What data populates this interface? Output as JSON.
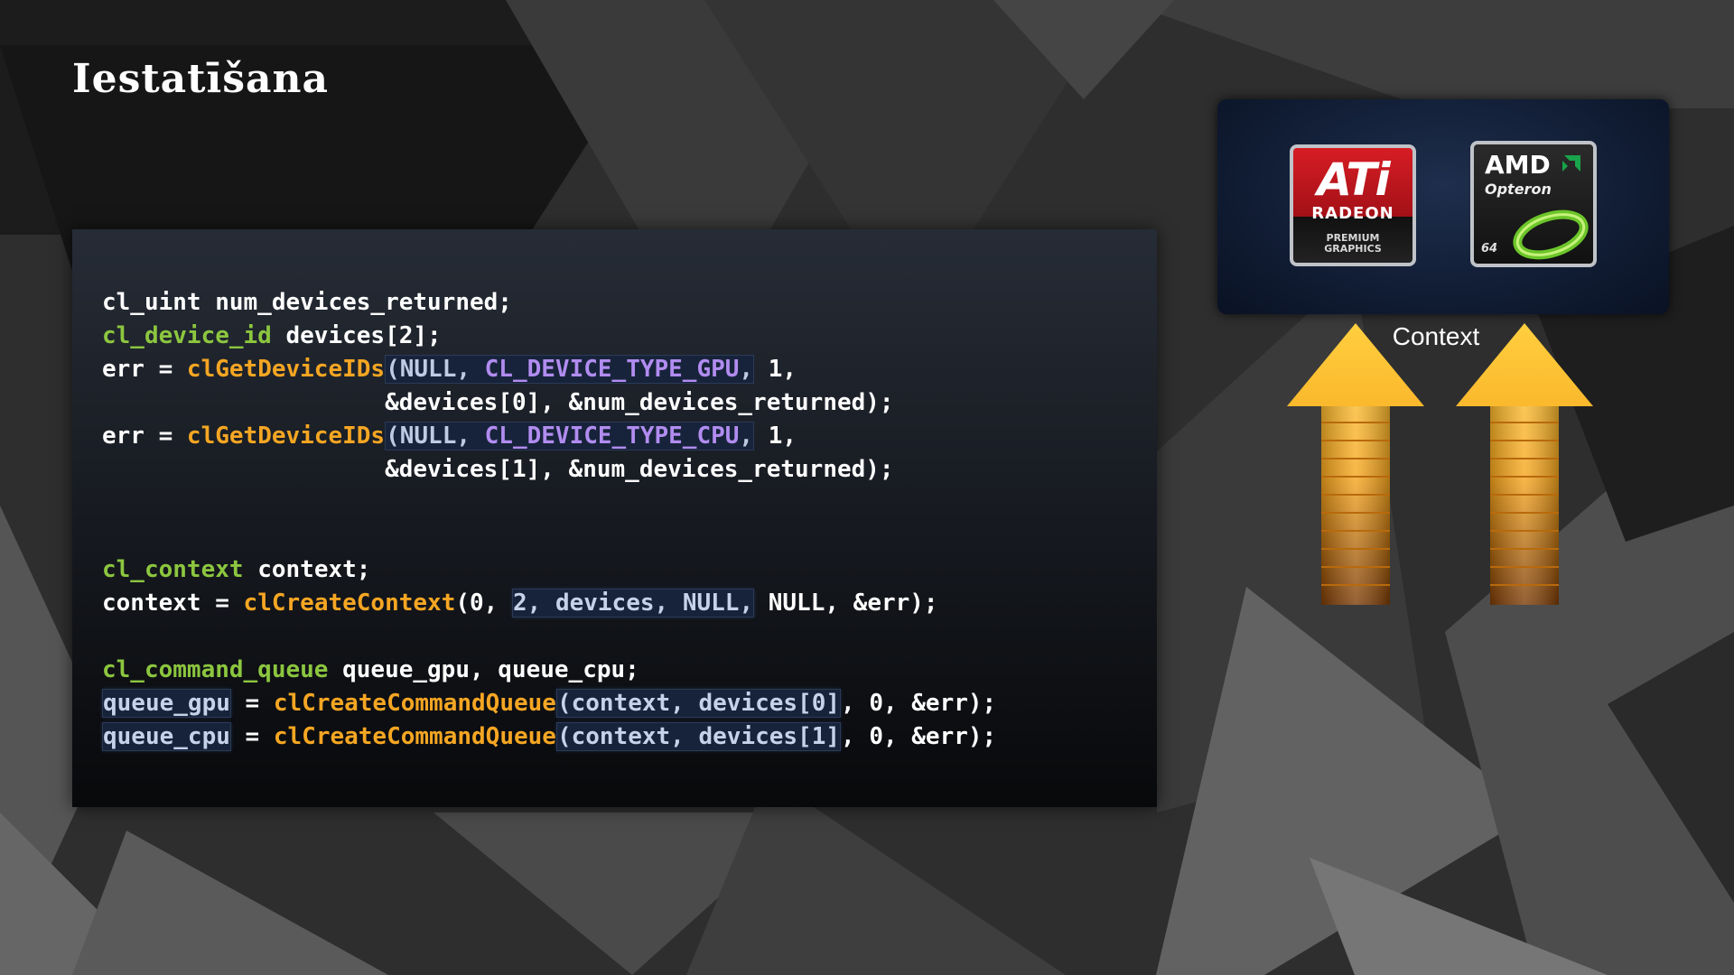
{
  "slide": {
    "title": "Iestatīšana",
    "context_label": "Context",
    "colors": {
      "type": "#8cc63f",
      "function": "#f5a623",
      "constant": "#b18cf0",
      "text": "#ffffff",
      "arrow": "#f7a51c"
    }
  },
  "code": {
    "l1_a": "cl_uint num_devices_returned;",
    "l2_type": "cl_device_id",
    "l2_rest": " devices[2];",
    "l3_pre": "err = ",
    "l3_fn": "clGetDeviceIDs",
    "l3_paren": "(",
    "l3_null": "NULL, ",
    "l3_const": "CL_DEVICE_TYPE_GPU",
    "l3_comma": ",",
    "l3_rest": " 1,",
    "l4": "                    &devices[0], &num_devices_returned);",
    "l5_pre": "err = ",
    "l5_fn": "clGetDeviceIDs",
    "l5_paren": "(",
    "l5_null": "NULL, ",
    "l5_const": "CL_DEVICE_TYPE_CPU",
    "l5_comma": ",",
    "l5_rest": " 1,",
    "l6": "                    &devices[1], &num_devices_returned);",
    "l7_type": "cl_context",
    "l7_rest": " context;",
    "l8_pre": "context = ",
    "l8_fn": "clCreateContext",
    "l8_mid": "(0, ",
    "l8_hl": "2, devices, NULL,",
    "l8_rest": " NULL, &err);",
    "l9_type": "cl_command_queue",
    "l9_rest": " queue_gpu, queue_cpu;",
    "l10_var": "queue_gpu",
    "l10_eq": " = ",
    "l10_fn": "clCreateCommandQueue",
    "l10_hl": "(context, devices[0]",
    "l10_rest": ", 0, &err);",
    "l11_var": "queue_cpu",
    "l11_eq": " = ",
    "l11_fn": "clCreateCommandQueue",
    "l11_hl": "(context, devices[1]",
    "l11_rest": ", 0, &err);"
  },
  "logos": {
    "ati": {
      "brand": "ATi",
      "product": "RADEON",
      "tagline_1": "PREMIUM",
      "tagline_2": "GRAPHICS"
    },
    "amd": {
      "brand": "AMD",
      "product": "Opteron",
      "bits": "64"
    }
  },
  "icons": [
    "ati-radeon-logo",
    "amd-opteron-logo",
    "up-arrow-icon"
  ]
}
